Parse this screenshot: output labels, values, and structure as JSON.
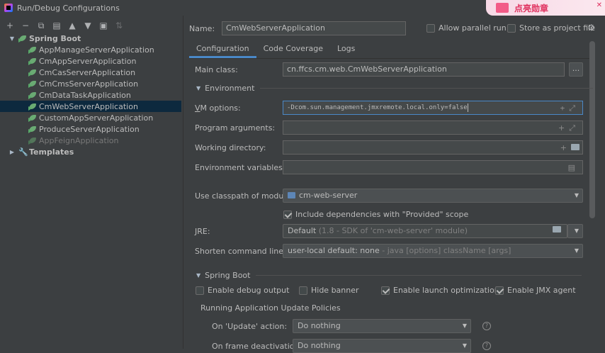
{
  "window": {
    "title": "Run/Debug Configurations"
  },
  "ad": {
    "text": "点亮勋章",
    "close": "✕"
  },
  "toolbar": {
    "add": "+",
    "remove": "−",
    "copy": "⧉",
    "save": "▤",
    "move_up": "▲",
    "move_down": "▼",
    "folder": "▣",
    "sort": "⇅"
  },
  "tree": {
    "spring_boot": "Spring Boot",
    "items": [
      "AppManageServerApplication",
      "CmAppServerApplication",
      "CmCasServerApplication",
      "CmCmsServerApplication",
      "CmDataTaskApplication",
      "CmWebServerApplication",
      "CustomAppServerApplication",
      "ProduceServerApplication",
      "AppFeignApplication"
    ],
    "selected_index": 5,
    "templates": "Templates"
  },
  "header": {
    "name_label": "Name:",
    "name_value": "CmWebServerApplication",
    "allow_parallel_run": "Allow parallel run",
    "store_as_project_file": "Store as project file"
  },
  "tabs": [
    "Configuration",
    "Code Coverage",
    "Logs"
  ],
  "config": {
    "main_class_label": "Main class:",
    "main_class_value": "cn.ffcs.cm.web.CmWebServerApplication",
    "browse": "...",
    "environment_section": "Environment",
    "vm_options_label": "VM options:",
    "vm_options_value": "-Dcom.sun.management.jmxremote.local.only=false",
    "program_arguments_label": "Program arguments:",
    "program_arguments_value": "",
    "working_directory_label": "Working directory:",
    "working_directory_value": "",
    "environment_variables_label": "Environment variables:",
    "environment_variables_value": "",
    "classpath_label": "Use classpath of module:",
    "classpath_value": "cm-web-server",
    "include_provided": "Include dependencies with \"Provided\" scope",
    "jre_label": "JRE:",
    "jre_value": "Default",
    "jre_hint": "(1.8 - SDK of 'cm-web-server' module)",
    "shorten_label": "Shorten command line:",
    "shorten_value": "user-local default: none",
    "shorten_hint": "- java [options] className [args]",
    "spring_boot_section": "Spring Boot",
    "enable_debug_output": "Enable debug output",
    "hide_banner": "Hide banner",
    "enable_launch_optimization": "Enable launch optimization",
    "enable_jmx_agent": "Enable JMX agent",
    "policies_title": "Running Application Update Policies",
    "on_update_label": "On 'Update' action:",
    "on_update_value": "Do nothing",
    "on_frame_label": "On frame deactivation:",
    "on_frame_value": "Do nothing"
  },
  "checkbox_states": {
    "allow_parallel_run": false,
    "store_as_project_file": false,
    "include_provided": true,
    "enable_debug_output": false,
    "hide_banner": false,
    "enable_launch_optimization": true,
    "enable_jmx_agent": true
  },
  "colors": {
    "background": "#3c3f41",
    "selection": "#0d293e",
    "accent": "#4a88c7",
    "spring_green": "#6aab73"
  }
}
